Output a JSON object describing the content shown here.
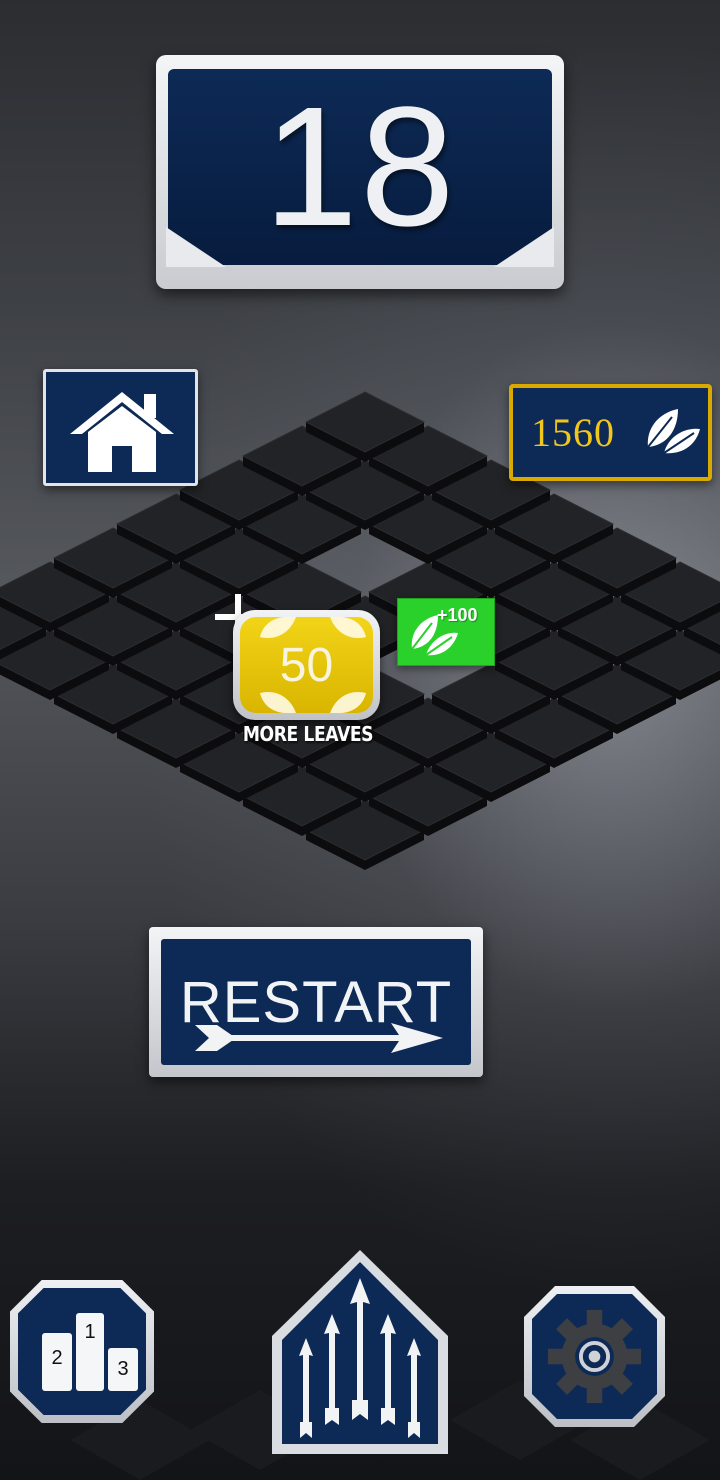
{
  "hud": {
    "score": "18",
    "leaves_count": "1560",
    "more_leaves_value": "50",
    "more_leaves_label": "MORE LEAVES",
    "bonus_label": "+100",
    "restart_label": "RESTART"
  },
  "leaderboard": {
    "ranks": [
      "1",
      "2",
      "3"
    ]
  },
  "icons": {
    "home": "home-icon",
    "leaf": "leaf-icon",
    "plus": "plus-icon",
    "arrow": "arrow-right-icon",
    "leaderboard": "podium-icon",
    "upgrade": "arrows-up-icon",
    "settings": "gear-icon"
  },
  "colors": {
    "panel_navy": "#0d2a56",
    "gold": "#f2c71c",
    "yellow_button": "#f2d418",
    "green_bonus": "#2bd12b",
    "silver_frame": "#e2e4e8"
  }
}
